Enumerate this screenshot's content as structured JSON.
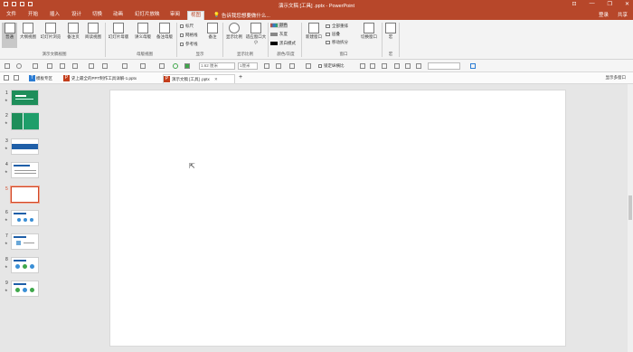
{
  "window": {
    "title": "演示文稿 [工具] .pptx - PowerPoint",
    "controls": {
      "minimize": "—",
      "restore": "❐",
      "close": "✕",
      "help": "⊡"
    }
  },
  "tabs": [
    {
      "label": "文件"
    },
    {
      "label": "开始"
    },
    {
      "label": "插入"
    },
    {
      "label": "设计"
    },
    {
      "label": "切换"
    },
    {
      "label": "动画"
    },
    {
      "label": "幻灯片放映"
    },
    {
      "label": "审阅"
    },
    {
      "label": "视图"
    }
  ],
  "tell_me": "告诉我您想要做什么...",
  "account": {
    "login": "登录",
    "share": "共享"
  },
  "ribbon": {
    "presentation_views": {
      "group_label": "演示文稿视图",
      "buttons": [
        "普通",
        "大纲视图",
        "幻灯片浏览",
        "备注页",
        "阅读视图"
      ]
    },
    "master_views": {
      "group_label": "母版视图",
      "buttons": [
        "幻灯片母版",
        "讲义母版",
        "备注母版"
      ]
    },
    "show": {
      "group_label": "显示",
      "options": [
        "标尺",
        "网格线",
        "参考线"
      ],
      "notes": "备注"
    },
    "zoom": {
      "group_label": "显示比例",
      "buttons": [
        "显示比例",
        "适应窗口大小"
      ]
    },
    "color": {
      "group_label": "颜色/灰度",
      "options": [
        "颜色",
        "灰度",
        "黑白模式"
      ]
    },
    "window": {
      "group_label": "窗口",
      "new_window": "新建窗口",
      "options": [
        "全部重排",
        "层叠",
        "移动拆分"
      ],
      "switch": "切换窗口"
    },
    "macros": {
      "group_label": "宏",
      "button": "宏"
    }
  },
  "toolbar2": {
    "line_weight": "1.62 厘米",
    "size_field": "1厘米",
    "lock_ratio": "锁定纵横比"
  },
  "doc_tabs": [
    {
      "label": "模板专区"
    },
    {
      "label": "史上最全的PPT制作工具详解-1.pptx"
    },
    {
      "label": "演示文稿 [工具] .pptx"
    }
  ],
  "doc_tabs_right": "显示多窗口",
  "slides": [
    {
      "num": "1",
      "has_star": true
    },
    {
      "num": "2",
      "has_star": true
    },
    {
      "num": "3",
      "has_star": true
    },
    {
      "num": "4",
      "has_star": true
    },
    {
      "num": "5",
      "has_star": false
    },
    {
      "num": "6",
      "has_star": true
    },
    {
      "num": "7",
      "has_star": true
    },
    {
      "num": "8",
      "has_star": true
    },
    {
      "num": "9",
      "has_star": true
    }
  ],
  "selected_slide": "5",
  "colors": {
    "accent": "#b7472a",
    "thumb_green": "#1e8e5a",
    "thumb_blue": "#1f5fa8"
  }
}
